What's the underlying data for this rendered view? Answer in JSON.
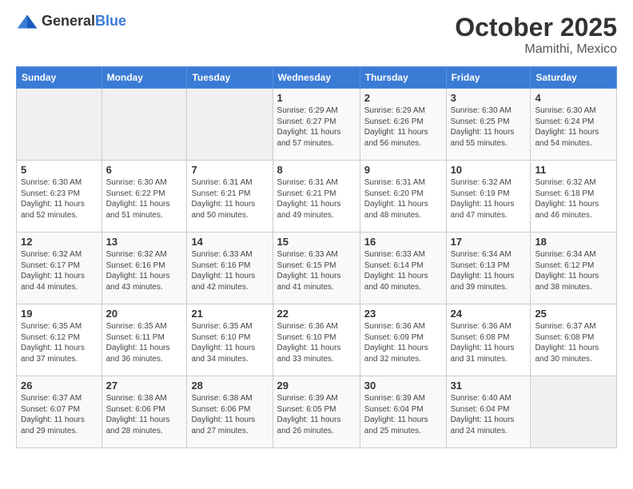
{
  "header": {
    "logo_general": "General",
    "logo_blue": "Blue",
    "month": "October 2025",
    "location": "Mamithi, Mexico"
  },
  "weekdays": [
    "Sunday",
    "Monday",
    "Tuesday",
    "Wednesday",
    "Thursday",
    "Friday",
    "Saturday"
  ],
  "weeks": [
    [
      {
        "day": "",
        "info": ""
      },
      {
        "day": "",
        "info": ""
      },
      {
        "day": "",
        "info": ""
      },
      {
        "day": "1",
        "info": "Sunrise: 6:29 AM\nSunset: 6:27 PM\nDaylight: 11 hours\nand 57 minutes."
      },
      {
        "day": "2",
        "info": "Sunrise: 6:29 AM\nSunset: 6:26 PM\nDaylight: 11 hours\nand 56 minutes."
      },
      {
        "day": "3",
        "info": "Sunrise: 6:30 AM\nSunset: 6:25 PM\nDaylight: 11 hours\nand 55 minutes."
      },
      {
        "day": "4",
        "info": "Sunrise: 6:30 AM\nSunset: 6:24 PM\nDaylight: 11 hours\nand 54 minutes."
      }
    ],
    [
      {
        "day": "5",
        "info": "Sunrise: 6:30 AM\nSunset: 6:23 PM\nDaylight: 11 hours\nand 52 minutes."
      },
      {
        "day": "6",
        "info": "Sunrise: 6:30 AM\nSunset: 6:22 PM\nDaylight: 11 hours\nand 51 minutes."
      },
      {
        "day": "7",
        "info": "Sunrise: 6:31 AM\nSunset: 6:21 PM\nDaylight: 11 hours\nand 50 minutes."
      },
      {
        "day": "8",
        "info": "Sunrise: 6:31 AM\nSunset: 6:21 PM\nDaylight: 11 hours\nand 49 minutes."
      },
      {
        "day": "9",
        "info": "Sunrise: 6:31 AM\nSunset: 6:20 PM\nDaylight: 11 hours\nand 48 minutes."
      },
      {
        "day": "10",
        "info": "Sunrise: 6:32 AM\nSunset: 6:19 PM\nDaylight: 11 hours\nand 47 minutes."
      },
      {
        "day": "11",
        "info": "Sunrise: 6:32 AM\nSunset: 6:18 PM\nDaylight: 11 hours\nand 46 minutes."
      }
    ],
    [
      {
        "day": "12",
        "info": "Sunrise: 6:32 AM\nSunset: 6:17 PM\nDaylight: 11 hours\nand 44 minutes."
      },
      {
        "day": "13",
        "info": "Sunrise: 6:32 AM\nSunset: 6:16 PM\nDaylight: 11 hours\nand 43 minutes."
      },
      {
        "day": "14",
        "info": "Sunrise: 6:33 AM\nSunset: 6:16 PM\nDaylight: 11 hours\nand 42 minutes."
      },
      {
        "day": "15",
        "info": "Sunrise: 6:33 AM\nSunset: 6:15 PM\nDaylight: 11 hours\nand 41 minutes."
      },
      {
        "day": "16",
        "info": "Sunrise: 6:33 AM\nSunset: 6:14 PM\nDaylight: 11 hours\nand 40 minutes."
      },
      {
        "day": "17",
        "info": "Sunrise: 6:34 AM\nSunset: 6:13 PM\nDaylight: 11 hours\nand 39 minutes."
      },
      {
        "day": "18",
        "info": "Sunrise: 6:34 AM\nSunset: 6:12 PM\nDaylight: 11 hours\nand 38 minutes."
      }
    ],
    [
      {
        "day": "19",
        "info": "Sunrise: 6:35 AM\nSunset: 6:12 PM\nDaylight: 11 hours\nand 37 minutes."
      },
      {
        "day": "20",
        "info": "Sunrise: 6:35 AM\nSunset: 6:11 PM\nDaylight: 11 hours\nand 36 minutes."
      },
      {
        "day": "21",
        "info": "Sunrise: 6:35 AM\nSunset: 6:10 PM\nDaylight: 11 hours\nand 34 minutes."
      },
      {
        "day": "22",
        "info": "Sunrise: 6:36 AM\nSunset: 6:10 PM\nDaylight: 11 hours\nand 33 minutes."
      },
      {
        "day": "23",
        "info": "Sunrise: 6:36 AM\nSunset: 6:09 PM\nDaylight: 11 hours\nand 32 minutes."
      },
      {
        "day": "24",
        "info": "Sunrise: 6:36 AM\nSunset: 6:08 PM\nDaylight: 11 hours\nand 31 minutes."
      },
      {
        "day": "25",
        "info": "Sunrise: 6:37 AM\nSunset: 6:08 PM\nDaylight: 11 hours\nand 30 minutes."
      }
    ],
    [
      {
        "day": "26",
        "info": "Sunrise: 6:37 AM\nSunset: 6:07 PM\nDaylight: 11 hours\nand 29 minutes."
      },
      {
        "day": "27",
        "info": "Sunrise: 6:38 AM\nSunset: 6:06 PM\nDaylight: 11 hours\nand 28 minutes."
      },
      {
        "day": "28",
        "info": "Sunrise: 6:38 AM\nSunset: 6:06 PM\nDaylight: 11 hours\nand 27 minutes."
      },
      {
        "day": "29",
        "info": "Sunrise: 6:39 AM\nSunset: 6:05 PM\nDaylight: 11 hours\nand 26 minutes."
      },
      {
        "day": "30",
        "info": "Sunrise: 6:39 AM\nSunset: 6:04 PM\nDaylight: 11 hours\nand 25 minutes."
      },
      {
        "day": "31",
        "info": "Sunrise: 6:40 AM\nSunset: 6:04 PM\nDaylight: 11 hours\nand 24 minutes."
      },
      {
        "day": "",
        "info": ""
      }
    ]
  ]
}
